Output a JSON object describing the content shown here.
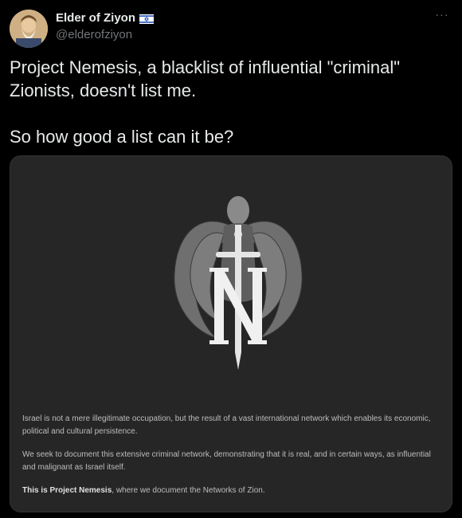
{
  "tweet": {
    "author": {
      "display_name": "Elder of Ziyon",
      "handle": "@elderofziyon",
      "flag_icon": "israel-flag-icon",
      "avatar_icon": "avatar-portrait"
    },
    "more_icon": "more-options-icon",
    "more_glyph": "···",
    "text": "Project Nemesis, a blacklist of influential \"criminal\" Zionists, doesn't list me.\n\nSo how good a list can it be?",
    "media": {
      "emblem_icon": "winged-angel-sword-n-emblem",
      "caption": {
        "p1": "Israel is not a mere illegitimate occupation, but the result of a vast international network which enables its economic, political and cultural persistence.",
        "p2": "We seek to document this extensive criminal network, demonstrating that it is real, and in certain ways, as influential and malignant as Israel itself.",
        "p3_bold": "This is Project Nemesis",
        "p3_rest": ", where we document the Networks of Zion."
      }
    },
    "colors": {
      "background": "#000000",
      "text": "#e7e9ea",
      "secondary": "#71767b",
      "media_background": "#262626"
    }
  }
}
